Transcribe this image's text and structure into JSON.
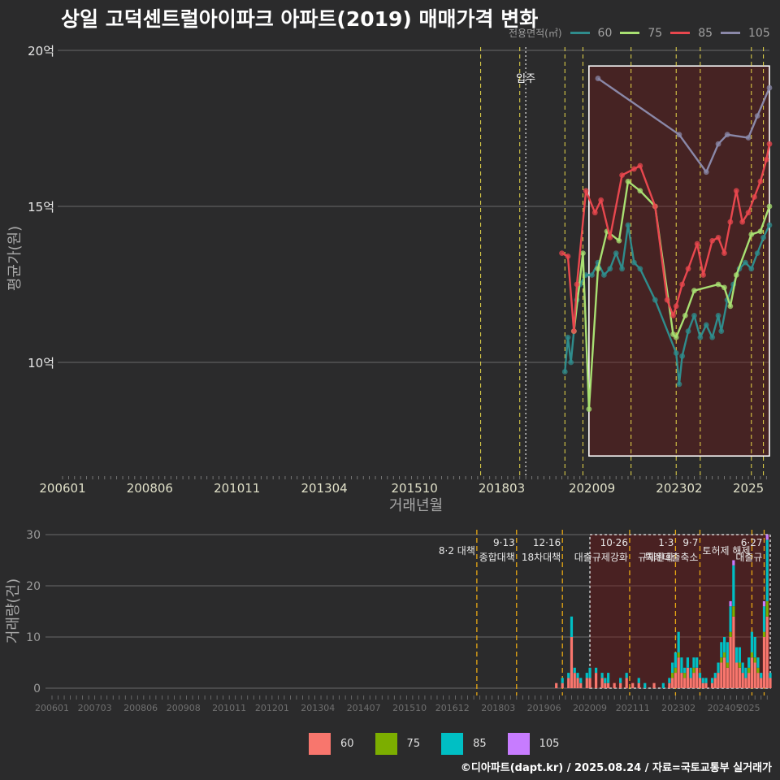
{
  "title": "상일 고덕센트럴아이파크 아파트(2019) 매매가격 변화",
  "credit": "©디아파트(dapt.kr) / 2025.08.24 / 자료=국토교통부 실거래가",
  "top_legend": {
    "title": "전용면적(㎡)",
    "items": [
      {
        "label": "60",
        "color": "#2f8c8c"
      },
      {
        "label": "75",
        "color": "#a8e072"
      },
      {
        "label": "85",
        "color": "#e8474e"
      },
      {
        "label": "105",
        "color": "#8a88a8"
      }
    ]
  },
  "bottom_legend": {
    "items": [
      {
        "label": "60",
        "color": "#f8766d"
      },
      {
        "label": "75",
        "color": "#7cae00"
      },
      {
        "label": "85",
        "color": "#00bfc4"
      },
      {
        "label": "105",
        "color": "#c77cff"
      }
    ]
  },
  "chart_data": [
    {
      "type": "line",
      "ylabel": "평균가(원)",
      "xlabel": "거래년월",
      "y_unit": "억",
      "ylim": [
        6.5,
        20.5
      ],
      "yticks": [
        10,
        15,
        20
      ],
      "ytick_labels": [
        "10억",
        "15억",
        "20억"
      ],
      "xtick_labels": [
        "200601",
        "200806",
        "201011",
        "201304",
        "201510",
        "201803",
        "202009",
        "202302",
        "2025"
      ],
      "x_range": [
        "2006-01",
        "2025-08"
      ],
      "move_in": {
        "label": "입주",
        "date": "2018-11"
      },
      "policy_lines": [
        "2017-08",
        "2018-09",
        "2019-12",
        "2020-06",
        "2021-10",
        "2023-01",
        "2023-09",
        "2025-02",
        "2025-06"
      ],
      "highlight_range": [
        "2020-08",
        "2025-08"
      ],
      "highlight_y": [
        7.0,
        19.5
      ],
      "series": [
        {
          "name": "60",
          "color": "#2f8c8c",
          "points": [
            [
              "2019-12",
              9.7
            ],
            [
              "2020-01",
              10.8
            ],
            [
              "2020-02",
              10.0
            ],
            [
              "2020-03",
              11.0
            ],
            [
              "2020-04",
              12.0
            ],
            [
              "2020-05",
              12.5
            ],
            [
              "2020-07",
              12.8
            ],
            [
              "2020-09",
              12.8
            ],
            [
              "2020-11",
              13.2
            ],
            [
              "2021-01",
              12.8
            ],
            [
              "2021-03",
              13.0
            ],
            [
              "2021-05",
              13.5
            ],
            [
              "2021-07",
              13.0
            ],
            [
              "2021-09",
              14.4
            ],
            [
              "2021-11",
              13.2
            ],
            [
              "2022-01",
              13.0
            ],
            [
              "2022-06",
              12.0
            ],
            [
              "2023-01",
              10.3
            ],
            [
              "2023-02",
              9.3
            ],
            [
              "2023-03",
              10.2
            ],
            [
              "2023-05",
              11.0
            ],
            [
              "2023-07",
              11.5
            ],
            [
              "2023-09",
              10.8
            ],
            [
              "2023-11",
              11.2
            ],
            [
              "2024-01",
              10.8
            ],
            [
              "2024-03",
              11.5
            ],
            [
              "2024-04",
              11.0
            ],
            [
              "2024-06",
              12.0
            ],
            [
              "2024-08",
              12.5
            ],
            [
              "2024-10",
              13.0
            ],
            [
              "2024-12",
              13.2
            ],
            [
              "2025-02",
              13.0
            ],
            [
              "2025-04",
              13.5
            ],
            [
              "2025-06",
              14.0
            ],
            [
              "2025-08",
              14.4
            ]
          ]
        },
        {
          "name": "75",
          "color": "#a8e072",
          "points": [
            [
              "2020-03",
              11.0
            ],
            [
              "2020-06",
              13.5
            ],
            [
              "2020-08",
              8.5
            ],
            [
              "2020-11",
              13.0
            ],
            [
              "2021-02",
              14.2
            ],
            [
              "2021-06",
              13.9
            ],
            [
              "2021-09",
              15.8
            ],
            [
              "2022-01",
              15.5
            ],
            [
              "2022-06",
              15.0
            ],
            [
              "2022-12",
              10.9
            ],
            [
              "2023-01",
              10.8
            ],
            [
              "2023-04",
              11.5
            ],
            [
              "2023-07",
              12.3
            ],
            [
              "2024-03",
              12.5
            ],
            [
              "2024-05",
              12.4
            ],
            [
              "2024-07",
              11.8
            ],
            [
              "2024-09",
              12.8
            ],
            [
              "2025-02",
              14.1
            ],
            [
              "2025-05",
              14.2
            ],
            [
              "2025-08",
              15.0
            ]
          ]
        },
        {
          "name": "85",
          "color": "#e8474e",
          "points": [
            [
              "2019-11",
              13.5
            ],
            [
              "2020-01",
              13.4
            ],
            [
              "2020-03",
              11.0
            ],
            [
              "2020-04",
              12.5
            ],
            [
              "2020-07",
              15.5
            ],
            [
              "2020-10",
              14.8
            ],
            [
              "2020-12",
              15.2
            ],
            [
              "2021-03",
              14.0
            ],
            [
              "2021-07",
              16.0
            ],
            [
              "2021-11",
              16.2
            ],
            [
              "2022-01",
              16.3
            ],
            [
              "2022-06",
              15.0
            ],
            [
              "2022-10",
              12.0
            ],
            [
              "2022-12",
              11.5
            ],
            [
              "2023-01",
              11.8
            ],
            [
              "2023-03",
              12.5
            ],
            [
              "2023-05",
              13.0
            ],
            [
              "2023-08",
              13.8
            ],
            [
              "2023-10",
              12.8
            ],
            [
              "2024-01",
              13.9
            ],
            [
              "2024-03",
              14.0
            ],
            [
              "2024-05",
              13.5
            ],
            [
              "2024-07",
              14.5
            ],
            [
              "2024-09",
              15.5
            ],
            [
              "2024-11",
              14.5
            ],
            [
              "2025-01",
              14.8
            ],
            [
              "2025-03",
              15.3
            ],
            [
              "2025-05",
              15.8
            ],
            [
              "2025-07",
              16.5
            ],
            [
              "2025-08",
              17.0
            ]
          ]
        },
        {
          "name": "105",
          "color": "#8a88a8",
          "points": [
            [
              "2020-11",
              19.1
            ],
            [
              "2023-02",
              17.3
            ],
            [
              "2023-11",
              16.1
            ],
            [
              "2024-03",
              17.0
            ],
            [
              "2024-06",
              17.3
            ],
            [
              "2025-01",
              17.2
            ],
            [
              "2025-04",
              17.9
            ],
            [
              "2025-08",
              18.8
            ]
          ]
        }
      ]
    },
    {
      "type": "bar",
      "ylabel": "거래량(건)",
      "ylim": [
        0,
        30
      ],
      "yticks": [
        0,
        10,
        20,
        30
      ],
      "xtick_labels": [
        "200601",
        "200703",
        "200806",
        "200908",
        "201011",
        "201201",
        "201304",
        "201407",
        "201510",
        "201612",
        "201803",
        "201906",
        "202009",
        "202111",
        "202302",
        "202405",
        "2025"
      ],
      "policy_annotations": [
        {
          "date": "2017-08",
          "label": "8·2 대책"
        },
        {
          "date": "2018-09",
          "label": "9·13\n종합대책"
        },
        {
          "date": "2019-12",
          "label": "12·16\n18차대책"
        },
        {
          "date": "2021-10",
          "label": "10·26\n대출규제강화"
        },
        {
          "date": "2023-01",
          "label": "1·3\n규제완화"
        },
        {
          "date": "2023-09",
          "label": "9·7\n특례대출축소"
        },
        {
          "date": "2025-02",
          "label": "토허제 해제"
        },
        {
          "date": "2025-06",
          "label": "6·27\n대출규"
        }
      ],
      "series_colors": {
        "60": "#f8766d",
        "75": "#7cae00",
        "85": "#00bfc4",
        "105": "#c77cff"
      },
      "months": [
        "2019-10",
        "2019-12",
        "2020-02",
        "2020-03",
        "2020-04",
        "2020-05",
        "2020-06",
        "2020-08",
        "2020-09",
        "2020-11",
        "2021-01",
        "2021-02",
        "2021-03",
        "2021-05",
        "2021-07",
        "2021-09",
        "2021-11",
        "2022-01",
        "2022-03",
        "2022-06",
        "2022-09",
        "2022-11",
        "2022-12",
        "2023-01",
        "2023-02",
        "2023-03",
        "2023-04",
        "2023-05",
        "2023-06",
        "2023-07",
        "2023-08",
        "2023-09",
        "2023-10",
        "2023-11",
        "2024-01",
        "2024-02",
        "2024-03",
        "2024-04",
        "2024-05",
        "2024-06",
        "2024-07",
        "2024-08",
        "2024-09",
        "2024-10",
        "2024-11",
        "2024-12",
        "2025-01",
        "2025-02",
        "2025-03",
        "2025-04",
        "2025-05",
        "2025-06",
        "2025-07",
        "2025-08"
      ],
      "stacks": [
        [
          1,
          0,
          0,
          0
        ],
        [
          1,
          0,
          1,
          0
        ],
        [
          2,
          0,
          1,
          0
        ],
        [
          10,
          0,
          4,
          0
        ],
        [
          3,
          0,
          1,
          0
        ],
        [
          2,
          0,
          1,
          0
        ],
        [
          1,
          0,
          1,
          0
        ],
        [
          2,
          0,
          1,
          0
        ],
        [
          2,
          0,
          2,
          0
        ],
        [
          3,
          0,
          1,
          0
        ],
        [
          2,
          0,
          1,
          0
        ],
        [
          1,
          0,
          1,
          0
        ],
        [
          1,
          0,
          2,
          0
        ],
        [
          1,
          0,
          0,
          0
        ],
        [
          1,
          0,
          1,
          0
        ],
        [
          2,
          0,
          1,
          0
        ],
        [
          1,
          0,
          0,
          0
        ],
        [
          1,
          0,
          1,
          0
        ],
        [
          0,
          0,
          1,
          0
        ],
        [
          1,
          0,
          0,
          0
        ],
        [
          0,
          0,
          1,
          0
        ],
        [
          1,
          0,
          1,
          0
        ],
        [
          2,
          1,
          2,
          0
        ],
        [
          3,
          1,
          3,
          0
        ],
        [
          6,
          1,
          4,
          0
        ],
        [
          3,
          0,
          3,
          0
        ],
        [
          2,
          1,
          1,
          0
        ],
        [
          4,
          0,
          2,
          0
        ],
        [
          2,
          0,
          2,
          0
        ],
        [
          3,
          1,
          2,
          0
        ],
        [
          4,
          0,
          2,
          0
        ],
        [
          2,
          0,
          1,
          0
        ],
        [
          1,
          0,
          1,
          0
        ],
        [
          1,
          0,
          1,
          0
        ],
        [
          1,
          0,
          1,
          0
        ],
        [
          2,
          0,
          1,
          0
        ],
        [
          3,
          0,
          2,
          0
        ],
        [
          5,
          1,
          3,
          0
        ],
        [
          6,
          1,
          3,
          0
        ],
        [
          4,
          1,
          4,
          0
        ],
        [
          10,
          1,
          5,
          1
        ],
        [
          14,
          2,
          8,
          1
        ],
        [
          5,
          0,
          3,
          0
        ],
        [
          4,
          1,
          3,
          0
        ],
        [
          3,
          0,
          2,
          0
        ],
        [
          2,
          0,
          2,
          0
        ],
        [
          3,
          1,
          2,
          0
        ],
        [
          6,
          1,
          4,
          0
        ],
        [
          5,
          1,
          4,
          0
        ],
        [
          3,
          1,
          2,
          0
        ],
        [
          2,
          0,
          1,
          0
        ],
        [
          10,
          1,
          5,
          1
        ],
        [
          14,
          3,
          12,
          1
        ],
        [
          2,
          0,
          1,
          0
        ]
      ]
    }
  ]
}
